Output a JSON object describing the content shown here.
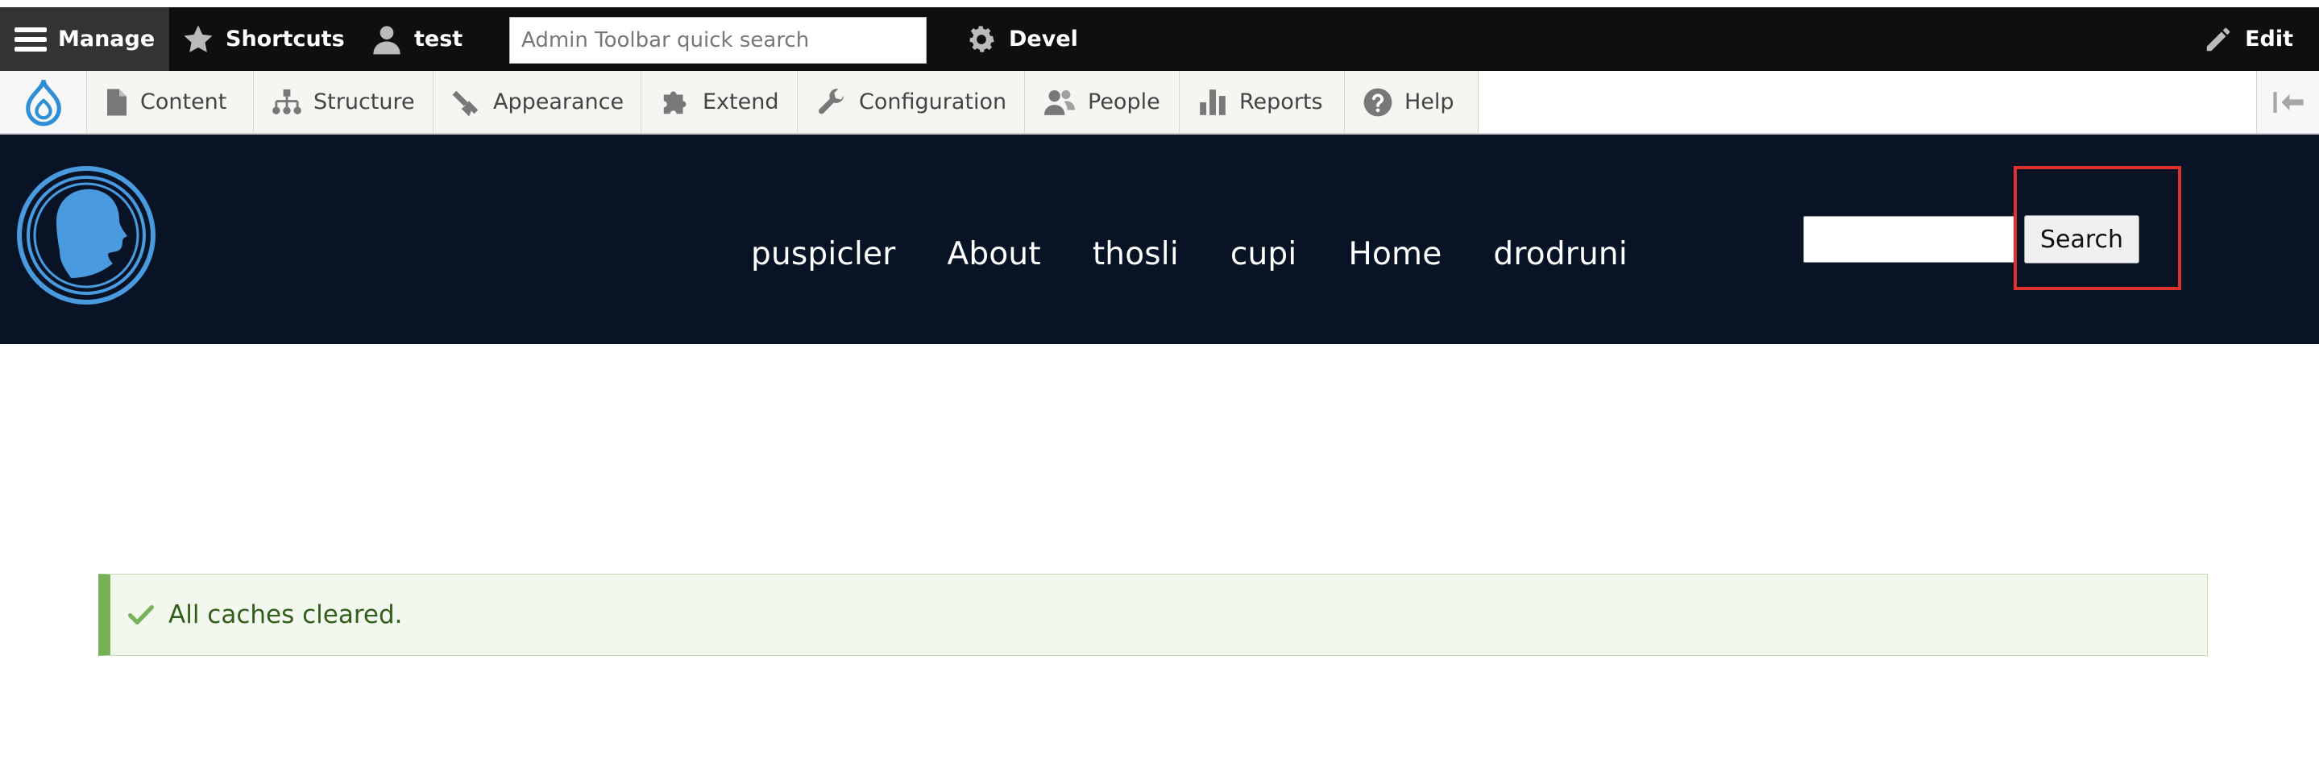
{
  "toolbar": {
    "manage": "Manage",
    "shortcuts": "Shortcuts",
    "user": "test",
    "search_placeholder": "Admin Toolbar quick search",
    "devel": "Devel",
    "edit": "Edit"
  },
  "tray": {
    "items": [
      {
        "label": "Content",
        "icon": "file-icon"
      },
      {
        "label": "Structure",
        "icon": "sitemap-icon"
      },
      {
        "label": "Appearance",
        "icon": "paintbrush-icon"
      },
      {
        "label": "Extend",
        "icon": "puzzle-icon"
      },
      {
        "label": "Configuration",
        "icon": "wrench-icon"
      },
      {
        "label": "People",
        "icon": "people-icon"
      },
      {
        "label": "Reports",
        "icon": "bar-chart-icon"
      },
      {
        "label": "Help",
        "icon": "help-icon"
      }
    ]
  },
  "site": {
    "nav": [
      "puspicler",
      "About",
      "thosli",
      "cupi",
      "Home",
      "drodruni"
    ],
    "search_button": "Search"
  },
  "status": {
    "message": "All caches cleared."
  },
  "colors": {
    "toolbar_bg": "#0f0f0f",
    "header_bg": "#081426",
    "highlight": "#e0312e",
    "status_accent": "#77b259",
    "status_text": "#325e1c"
  }
}
